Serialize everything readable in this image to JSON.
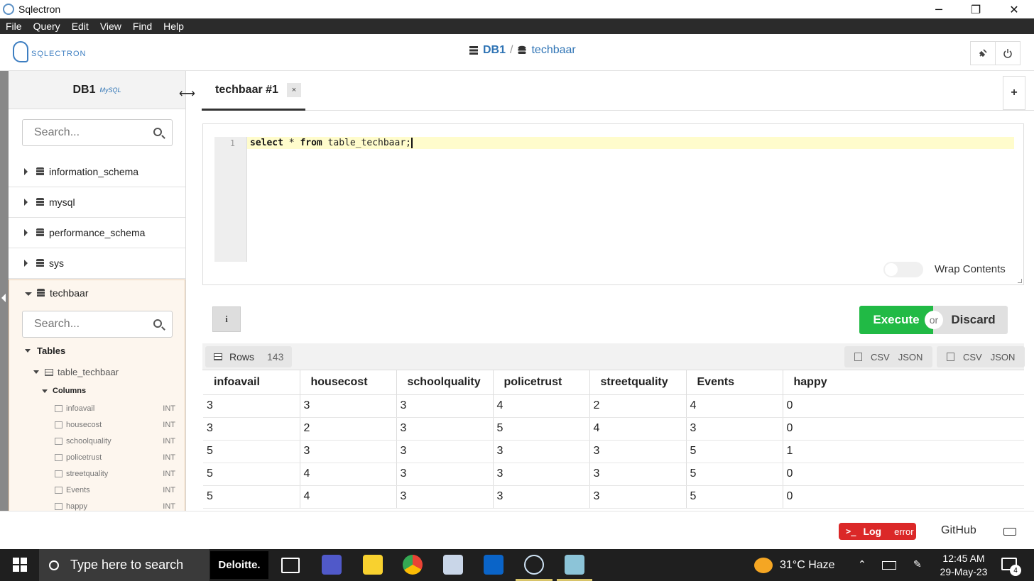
{
  "window": {
    "title": "Sqlectron",
    "minimize": "─",
    "maximize": "❐",
    "close": "✕"
  },
  "menu": [
    "File",
    "Query",
    "Edit",
    "View",
    "Find",
    "Help"
  ],
  "header": {
    "logo_text": "SQLECTRON",
    "breadcrumb": {
      "server": "DB1",
      "database": "techbaar",
      "separator": "/"
    }
  },
  "sidebar": {
    "server_name": "DB1",
    "server_badge": "MySQL",
    "search_placeholder": "Search...",
    "databases": [
      "information_schema",
      "mysql",
      "performance_schema",
      "sys"
    ],
    "expanded": {
      "name": "techbaar",
      "search_placeholder": "Search...",
      "tables_label": "Tables",
      "table_name": "table_techbaar",
      "columns_label": "Columns",
      "columns": [
        {
          "name": "infoavail",
          "type": "INT"
        },
        {
          "name": "housecost",
          "type": "INT"
        },
        {
          "name": "schoolquality",
          "type": "INT"
        },
        {
          "name": "policetrust",
          "type": "INT"
        },
        {
          "name": "streetquality",
          "type": "INT"
        },
        {
          "name": "Events",
          "type": "INT"
        },
        {
          "name": "happy",
          "type": "INT"
        }
      ]
    }
  },
  "tabs": {
    "active_label": "techbaar #1",
    "close_label": "×",
    "add_label": "+"
  },
  "editor": {
    "line_number": "1",
    "query_keyword1": "select",
    "query_rest1": " * ",
    "query_keyword2": "from",
    "query_rest2": " table_techbaar;",
    "wrap_label": "Wrap Contents"
  },
  "actions": {
    "info_label": "i",
    "execute_label": "Execute",
    "or_label": "or",
    "discard_label": "Discard"
  },
  "results": {
    "rows_label": "Rows",
    "rows_count": "143",
    "export": {
      "csv": "CSV",
      "json": "JSON"
    },
    "columns": [
      "infoavail",
      "housecost",
      "schoolquality",
      "policetrust",
      "streetquality",
      "Events",
      "happy"
    ],
    "rows": [
      [
        "3",
        "3",
        "3",
        "4",
        "2",
        "4",
        "0"
      ],
      [
        "3",
        "2",
        "3",
        "5",
        "4",
        "3",
        "0"
      ],
      [
        "5",
        "3",
        "3",
        "3",
        "3",
        "5",
        "1"
      ],
      [
        "5",
        "4",
        "3",
        "3",
        "3",
        "5",
        "0"
      ],
      [
        "5",
        "4",
        "3",
        "3",
        "3",
        "5",
        "0"
      ]
    ]
  },
  "statusbar": {
    "log_prompt": ">_",
    "log_label": "Log",
    "error_label": "error",
    "github_label": "GitHub"
  },
  "taskbar": {
    "search_placeholder": "Type here to search",
    "deloitte_label": "Deloitte.",
    "weather": "31°C  Haze",
    "time": "12:45 AM",
    "date": "29-May-23",
    "notification_count": "4"
  }
}
